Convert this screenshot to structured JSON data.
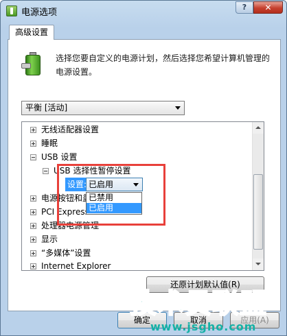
{
  "window": {
    "title": "电源选项",
    "help_label": "?",
    "close_label": "✕"
  },
  "tab": {
    "label": "高级设置"
  },
  "intro": {
    "icon": "power-battery-icon",
    "text": "选择您要自定义的电源计划，然后选择您希望计算机管理的电源设置。"
  },
  "plan_select": {
    "value": "平衡 [活动]"
  },
  "tree": {
    "items": [
      {
        "label": "无线适配器设置",
        "expander": "+"
      },
      {
        "label": "睡眠",
        "expander": "+"
      },
      {
        "label": "USB 设置",
        "expander": "-"
      },
      {
        "label": "USB 选择性暂停设置",
        "expander": "-"
      },
      {
        "label": "电源按钮和盖",
        "expander": "+"
      },
      {
        "label": "PCI Express",
        "expander": "+"
      },
      {
        "label": "处理器电源管理",
        "expander": "+"
      },
      {
        "label": "显示",
        "expander": "+"
      },
      {
        "label": "“多媒体”设置",
        "expander": "+"
      },
      {
        "label": "Internet Explorer",
        "expander": "+"
      }
    ],
    "setting": {
      "label": "设置:",
      "value": "已启用",
      "options": [
        "已禁用",
        "已启用"
      ],
      "selected_option": "已启用"
    }
  },
  "buttons": {
    "restore": "还原计划默认值(R)",
    "ok": "确定",
    "cancel": "取消",
    "apply": "应用(A)"
  },
  "watermark": {
    "text": "技术员联盟",
    "url": "www.jsgho.com"
  },
  "colors": {
    "highlight_box": "#e8403a",
    "selection": "#3399ff",
    "watermark": "#15b1a6"
  }
}
